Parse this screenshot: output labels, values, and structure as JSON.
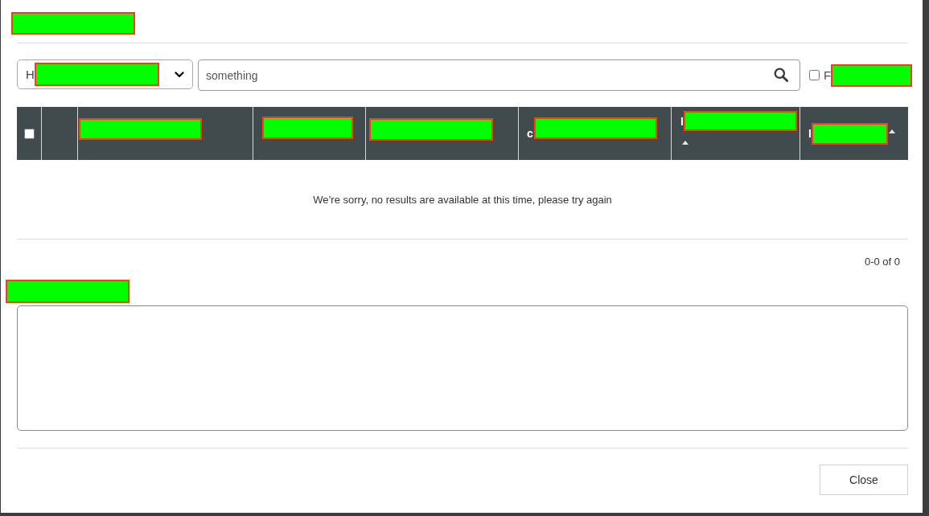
{
  "dialog": {
    "title": {
      "redacted": true
    }
  },
  "filter_bar": {
    "dropdown": {
      "value": "H",
      "redacted": true
    },
    "search": {
      "value": "something"
    },
    "checkbox": {
      "label": "F",
      "redacted": true,
      "checked": false
    }
  },
  "table": {
    "select_all": {
      "checked": false
    },
    "columns": [
      {
        "redacted": false,
        "sorted": false
      },
      {
        "redacted": true,
        "sorted": false
      },
      {
        "redacted": true,
        "sorted": false
      },
      {
        "redacted": true,
        "sorted": false
      },
      {
        "label": "c",
        "redacted": true,
        "sorted": false
      },
      {
        "label": "I",
        "redacted": true,
        "sorted": true
      },
      {
        "label": "I",
        "redacted": true,
        "sorted": true
      }
    ],
    "empty_message": "We’re sorry, no results are available at this time, please try again",
    "pagination": "0-0 of 0"
  },
  "notes": {
    "label": {
      "redacted": true
    }
  },
  "footer": {
    "buttons": [
      {
        "label": "Close"
      }
    ]
  }
}
